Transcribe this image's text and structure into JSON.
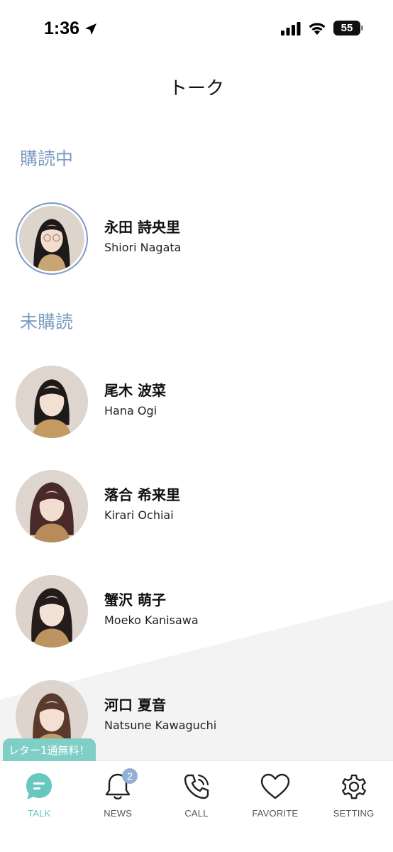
{
  "status_bar": {
    "time": "1:36",
    "battery": "55"
  },
  "header": {
    "title": "トーク"
  },
  "sections": {
    "subscribed": {
      "title": "購読中",
      "members": [
        {
          "name_ja": "永田 詩央里",
          "name_en": "Shiori Nagata"
        }
      ]
    },
    "unsubscribed": {
      "title": "未購読",
      "members": [
        {
          "name_ja": "尾木 波菜",
          "name_en": "Hana Ogi"
        },
        {
          "name_ja": "落合 希来里",
          "name_en": "Kirari Ochiai"
        },
        {
          "name_ja": "蟹沢 萌子",
          "name_en": "Moeko Kanisawa"
        },
        {
          "name_ja": "河口 夏音",
          "name_en": "Natsune Kawaguchi"
        }
      ]
    }
  },
  "promo": {
    "label": "レター1通無料！"
  },
  "tabs": [
    {
      "label": "TALK",
      "icon": "talk-bubble-icon",
      "active": true
    },
    {
      "label": "NEWS",
      "icon": "bell-icon",
      "badge": "2"
    },
    {
      "label": "CALL",
      "icon": "phone-icon"
    },
    {
      "label": "FAVORITE",
      "icon": "heart-icon"
    },
    {
      "label": "SETTING",
      "icon": "gear-icon"
    }
  ],
  "colors": {
    "accent": "#5fc6bb",
    "section": "#7c9bc4",
    "badge": "#93afd3"
  }
}
